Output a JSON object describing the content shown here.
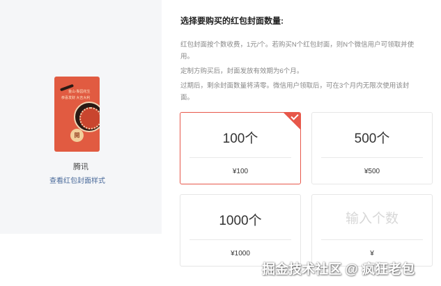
{
  "preview": {
    "card_line1": "金山·梨园花生",
    "card_line2": "恭喜发财  大吉大利",
    "open_label": "開",
    "name": "腾讯",
    "link_label": "查看红包封面样式"
  },
  "purchase": {
    "title": "选择要购买的红包封面数量:",
    "desc_lines": [
      "红包封面按个数收费，1元/个。若购买N个红包封面，则N个微信用户可领取并使",
      "用。",
      "定制方购买后，封面发放有效期为6个月。",
      "过期后，剩余封面数量将清零。微信用户领取后，可在3个月内无限次使用该封",
      "面。"
    ],
    "options": [
      {
        "qty": "100个",
        "price": "¥100",
        "selected": true
      },
      {
        "qty": "500个",
        "price": "¥500",
        "selected": false
      },
      {
        "qty": "1000个",
        "price": "¥1000",
        "selected": false
      }
    ],
    "custom": {
      "placeholder": "输入个数",
      "price": "¥"
    }
  },
  "watermark": "掘金技术社区 @ 疯狂老包",
  "colors": {
    "accent": "#e7574a",
    "link": "#4a6a9a",
    "cover": "#e15b41"
  }
}
